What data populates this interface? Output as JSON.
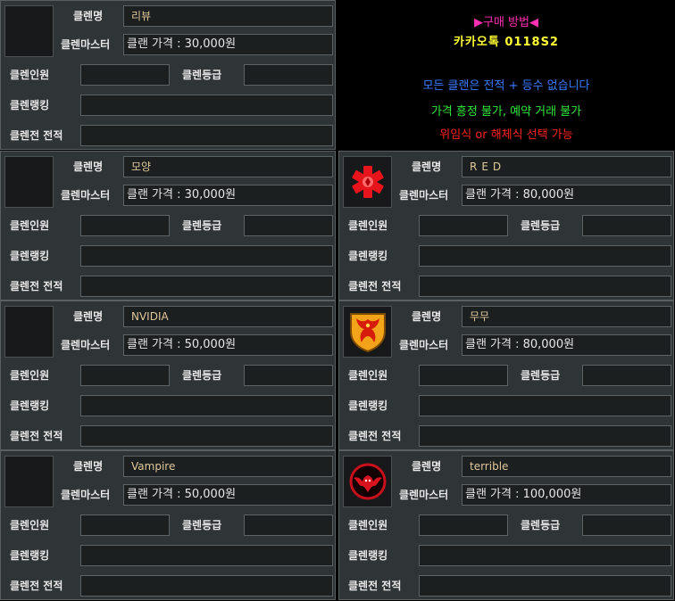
{
  "labels": {
    "clan_name": "클렌명",
    "clan_master": "클렌마스터",
    "clan_members": "클렌인원",
    "clan_grade": "클렌등급",
    "clan_ranking": "클렌랭킹",
    "clan_war_record": "클렌전 전적"
  },
  "info": {
    "title": "구매 방법",
    "contact": "카카오톡 0118S2",
    "line1": "모든 클랜은 전적 + 등수 없습니다",
    "line2": "가격 흥정 불가, 예약 거래 불가",
    "line3": "위임식 or 해체식 선택 가능"
  },
  "clans": [
    {
      "name": "리뷰",
      "master": "클랜 가격 : 30,000원",
      "emblem": "none"
    },
    {
      "name": "모양",
      "master": "클랜 가격 : 30,000원",
      "emblem": "none"
    },
    {
      "name": "RED",
      "master": "클랜 가격 : 80,000원",
      "emblem": "red-medical-cross-icon"
    },
    {
      "name": "NVIDIA",
      "master": "클랜 가격 : 50,000원",
      "emblem": "none"
    },
    {
      "name": "무무",
      "master": "클랜 가격 : 80,000원",
      "emblem": "phoenix-shield-icon"
    },
    {
      "name": "Vampire",
      "master": "클랜 가격 : 50,000원",
      "emblem": "none"
    },
    {
      "name": "terrible",
      "master": "클랜 가격 : 100,000원",
      "emblem": "red-bat-circle-icon"
    }
  ]
}
